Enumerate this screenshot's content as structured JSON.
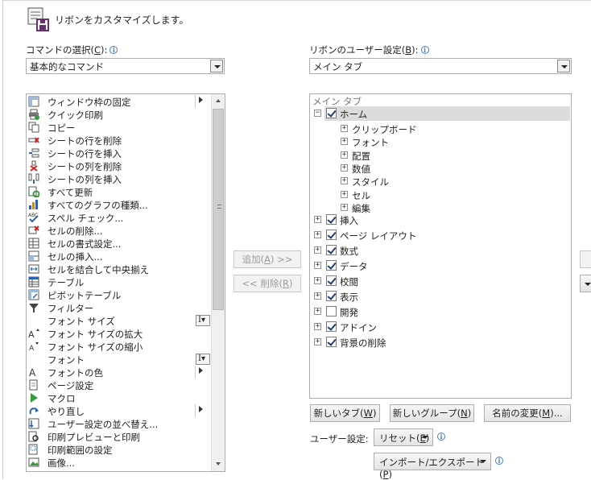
{
  "header": {
    "title": "リボンをカスタマイズします。"
  },
  "commands_label": {
    "text": "コマンドの選択(",
    "key": "C",
    "tail": "):"
  },
  "commands_combo": {
    "value": "基本的なコマンド"
  },
  "ribbon_label": {
    "text": "リボンのユーザー設定(",
    "key": "B",
    "tail": "):"
  },
  "ribbon_combo": {
    "value": "メイン タブ"
  },
  "command_list": [
    {
      "label": "ウィンドウ枠の固定",
      "icon": "freeze-panes-icon",
      "submenu": true
    },
    {
      "label": "クイック印刷",
      "icon": "quick-print-icon"
    },
    {
      "label": "コピー",
      "icon": "copy-icon"
    },
    {
      "label": "シートの行を削除",
      "icon": "delete-row-icon"
    },
    {
      "label": "シートの行を挿入",
      "icon": "insert-row-icon"
    },
    {
      "label": "シートの列を削除",
      "icon": "delete-column-icon"
    },
    {
      "label": "シートの列を挿入",
      "icon": "insert-column-icon"
    },
    {
      "label": "すべて更新",
      "icon": "refresh-all-icon"
    },
    {
      "label": "すべてのグラフの種類...",
      "icon": "chart-icon"
    },
    {
      "label": "スペル チェック...",
      "icon": "spelling-icon"
    },
    {
      "label": "セルの削除...",
      "icon": "delete-cell-icon"
    },
    {
      "label": "セルの書式設定...",
      "icon": "format-cell-icon"
    },
    {
      "label": "セルの挿入...",
      "icon": "insert-cell-icon"
    },
    {
      "label": "セルを結合して中央揃え",
      "icon": "merge-center-icon"
    },
    {
      "label": "テーブル",
      "icon": "table-icon"
    },
    {
      "label": "ピボットテーブル",
      "icon": "pivot-table-icon"
    },
    {
      "label": "フィルター",
      "icon": "filter-icon"
    },
    {
      "label": "フォント サイズ",
      "icon": "",
      "ibeam": true
    },
    {
      "label": "フォント サイズの拡大",
      "icon": "font-grow-icon"
    },
    {
      "label": "フォント サイズの縮小",
      "icon": "font-shrink-icon"
    },
    {
      "label": "フォント",
      "icon": "",
      "ibeam": true
    },
    {
      "label": "フォントの色",
      "icon": "font-color-icon",
      "submenu": true
    },
    {
      "label": "ページ設定",
      "icon": "page-setup-icon"
    },
    {
      "label": "マクロ",
      "icon": "macro-icon"
    },
    {
      "label": "やり直し",
      "icon": "redo-icon",
      "submenu": true
    },
    {
      "label": "ユーザー設定の並べ替え...",
      "icon": "sort-icon"
    },
    {
      "label": "印刷プレビューと印刷",
      "icon": "print-preview-icon"
    },
    {
      "label": "印刷範囲の設定",
      "icon": "print-area-icon"
    },
    {
      "label": "画像...",
      "icon": "picture-icon"
    }
  ],
  "add_button": {
    "text": "追加(",
    "key": "A",
    "tail": ") >>"
  },
  "remove_button": {
    "text": "<< 削除(",
    "key": "R",
    "tail": ")"
  },
  "tree": {
    "header": "メイン タブ",
    "home": {
      "label": "ホーム",
      "checked": true,
      "expander": "⊟"
    },
    "groups": [
      "クリップボード",
      "フォント",
      "配置",
      "数値",
      "スタイル",
      "セル",
      "編集"
    ],
    "tabs": [
      {
        "label": "挿入",
        "checked": true
      },
      {
        "label": "ページ レイアウト",
        "checked": true
      },
      {
        "label": "数式",
        "checked": true
      },
      {
        "label": "データ",
        "checked": true
      },
      {
        "label": "校閲",
        "checked": true
      },
      {
        "label": "表示",
        "checked": true
      },
      {
        "label": "開発",
        "checked": false
      },
      {
        "label": "アドイン",
        "checked": true
      },
      {
        "label": "背景の削除",
        "checked": true
      }
    ],
    "expander_plus": "⊞"
  },
  "new_tab_button": {
    "text": "新しいタブ(",
    "key": "W",
    "tail": ")"
  },
  "new_group_button": {
    "text": "新しいグループ(",
    "key": "N",
    "tail": ")"
  },
  "rename_button": {
    "text": "名前の変更(",
    "key": "M",
    "tail": ")..."
  },
  "user_settings_label": "ユーザー設定:",
  "reset_button": {
    "text": "リセット(",
    "key": "E",
    "tail": ")"
  },
  "import_export_button": {
    "text": "インポート/エクスポート(",
    "key": "P",
    "tail": ")"
  },
  "info_glyph": "i",
  "colors": {
    "accent": "#4a7ebb",
    "check": "#1f3c78",
    "selection": "#dcdcdc"
  }
}
